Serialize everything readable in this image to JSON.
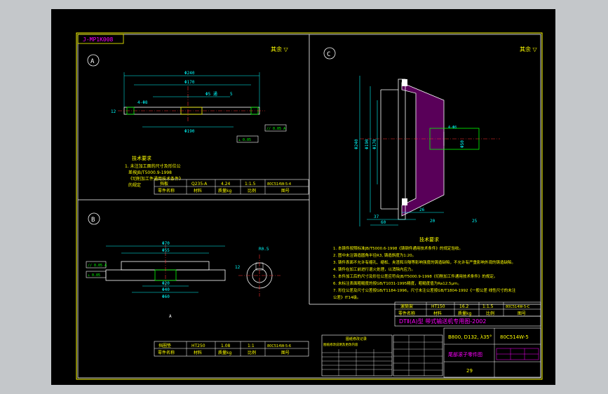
{
  "drawing": {
    "title_tag": "J-MP1K008",
    "views": {
      "a": "A",
      "b": "B",
      "c": "C"
    },
    "roughness_note": "其余 ▽",
    "view_a": {
      "dims": [
        "Φ240",
        "Φ170",
        "Φ5 通",
        "5",
        "Φ190",
        "4-Φ8",
        "12"
      ],
      "fcf": [
        "// 0.05 A",
        "⊥ 0.05"
      ],
      "notes": [
        "技术要求",
        "1. 未注加工面的尺寸及形位公",
        "差按JB/T5000.9-1998",
        "《切削加工件通用技术条件》",
        "的规定"
      ]
    },
    "view_b": {
      "dims": [
        "Φ70",
        "Φ55",
        "Φ20",
        "Φ40",
        "Φ60",
        "A",
        "R0.5",
        "12"
      ],
      "fcf": [
        "// 0.05 A",
        "⊥ 0.05"
      ]
    },
    "view_c": {
      "dims": [
        "Φ240",
        "Φ190",
        "Φ170",
        "Φ50",
        "4-Φ8",
        "37",
        "26",
        "60",
        "20",
        "25"
      ]
    },
    "notes_c": {
      "title": "技术要求",
      "lines": [
        "1. 本铸件按照标准JB/T5000.6-1998《铸钢件通用技术条件》的规定验收。",
        "2. 图中未注铸造圆角半径R3, 铸造斜度为1:20。",
        "3. 铸件表面不允许有缩孔、缩松、夹渣和冷隔等影响强度的铸造缺陷，不允许有严重影响外观的铸造缺陷。",
        "4. 铸件在加工前进行退火处理，以消除内应力。",
        "5. 本件加工后的尺寸及形位公差应符合JB/T5000.9-1998《切削加工件通用技术条件》的规定。",
        "6. 未标注表面粗糙度的按GB/T1031-1995精度，粗糙度值为Ra12.5μm。",
        "7. 形位公差及尺寸公差按GB/T1184-1996，尺寸未注公差按GB/T1804-1992《一般公差 线性尺寸的未注",
        "   公差》IT14级。"
      ]
    },
    "title_block_a": {
      "row1": [
        "挡板",
        "Q235-A",
        "4.24",
        "1:1.5",
        "80C514W-5-4"
      ],
      "row2": [
        "零件名称",
        "材料",
        "质量kg",
        "比例",
        "图号"
      ]
    },
    "title_block_b": {
      "row1": [
        "挡圈垫",
        "HT250",
        "1.08",
        "1:1",
        "80C514W-5-6"
      ],
      "row2": [
        "零件名称",
        "材料",
        "质量kg",
        "比例",
        "图号"
      ]
    },
    "title_block_c": {
      "row1": [
        "滚筒架",
        "HT150",
        "16.2",
        "1:1.5",
        "80C514W-5-C"
      ],
      "row2": [
        "零件名称",
        "材料",
        "质量kg",
        "比例",
        "图号"
      ]
    },
    "main_title": "DTⅡ(A)型 带式输送机专用图-2002",
    "spec": "B800, D132, λ35°",
    "drawing_no": "80C514W-5",
    "part_title": "尾部滚子零件图",
    "sheet": "29",
    "rev_table_title": "图纸修改记录",
    "rev_note": "图纸修改说明及更改内容"
  },
  "colors": {
    "bg": "#000000",
    "line": "#ffffff",
    "yellow": "#ffff00",
    "green": "#00ff00",
    "magenta": "#ff00ff",
    "cyan": "#00ffff",
    "red": "#ff3030"
  }
}
